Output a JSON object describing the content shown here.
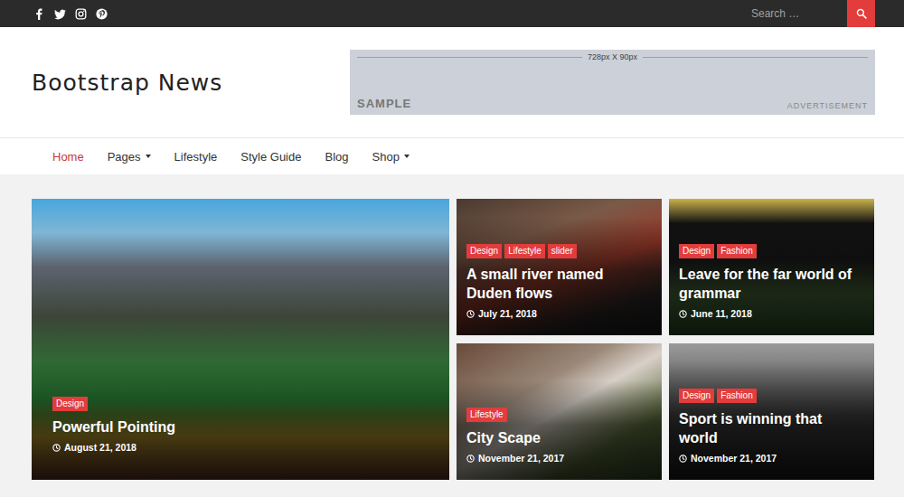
{
  "search": {
    "placeholder": "Search …"
  },
  "logo": "Bootstrap News",
  "ad": {
    "size": "728px X 90px",
    "label": "SAMPLE",
    "caption": "ADVERTISEMENT"
  },
  "nav": [
    {
      "label": "Home",
      "selected": true,
      "has_menu": false
    },
    {
      "label": "Pages",
      "selected": false,
      "has_menu": true
    },
    {
      "label": "Lifestyle",
      "selected": false,
      "has_menu": false
    },
    {
      "label": "Style Guide",
      "selected": false,
      "has_menu": false
    },
    {
      "label": "Blog",
      "selected": false,
      "has_menu": false
    },
    {
      "label": "Shop",
      "selected": false,
      "has_menu": true
    }
  ],
  "posts": [
    {
      "tags": [
        "Design"
      ],
      "title": "Powerful Pointing",
      "date": "August 21, 2018"
    },
    {
      "tags": [
        "Design",
        "Lifestyle",
        "slider"
      ],
      "title": "A small river named Duden flows",
      "date": "July 21, 2018"
    },
    {
      "tags": [
        "Design",
        "Fashion"
      ],
      "title": "Leave for the far world of grammar",
      "date": "June 11, 2018"
    },
    {
      "tags": [
        "Lifestyle"
      ],
      "title": "City Scape",
      "date": "November 21, 2017"
    },
    {
      "tags": [
        "Design",
        "Fashion"
      ],
      "title": "Sport is winning that world",
      "date": "November 21, 2017"
    }
  ]
}
